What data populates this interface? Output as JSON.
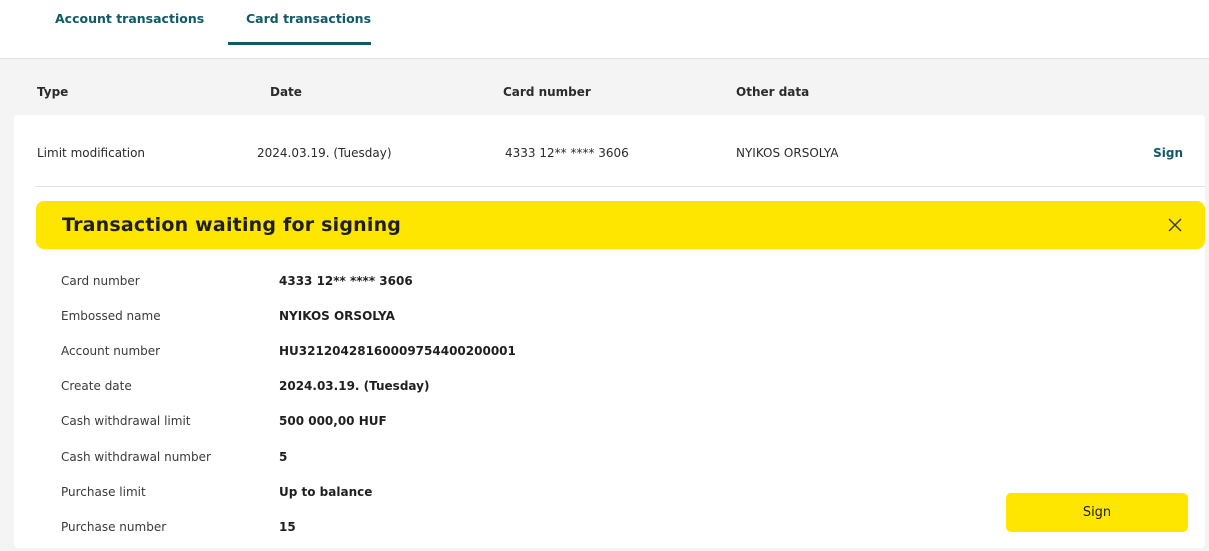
{
  "tabs": [
    {
      "label": "Account transactions",
      "active": false
    },
    {
      "label": "Card transactions",
      "active": true
    }
  ],
  "table": {
    "headers": [
      "Type",
      "Date",
      "Card number",
      "Other data"
    ],
    "rows": [
      {
        "type": "Limit modification",
        "date": "2024.03.19. (Tuesday)",
        "card_number": "4333 12** **** 3606",
        "other_data": "NYIKOS ORSOLYA",
        "action": "Sign"
      }
    ]
  },
  "banner": {
    "title": "Transaction waiting for signing",
    "close_icon": "close-icon"
  },
  "details": [
    {
      "label": "Card number",
      "value": "4333 12** **** 3606"
    },
    {
      "label": "Embossed name",
      "value": "NYIKOS ORSOLYA"
    },
    {
      "label": "Account number",
      "value": "HU32120428160009754400200001"
    },
    {
      "label": "Create date",
      "value": "2024.03.19. (Tuesday)"
    },
    {
      "label": "Cash withdrawal limit",
      "value": "500 000,00 HUF"
    },
    {
      "label": "Cash withdrawal number",
      "value": "5"
    },
    {
      "label": "Purchase limit",
      "value": "Up to balance"
    },
    {
      "label": "Purchase number",
      "value": "15"
    }
  ],
  "sign_button": {
    "label": "Sign"
  },
  "colors": {
    "accent": "#0f5a66",
    "highlight": "#ffe600",
    "background": "#f4f4f4"
  }
}
